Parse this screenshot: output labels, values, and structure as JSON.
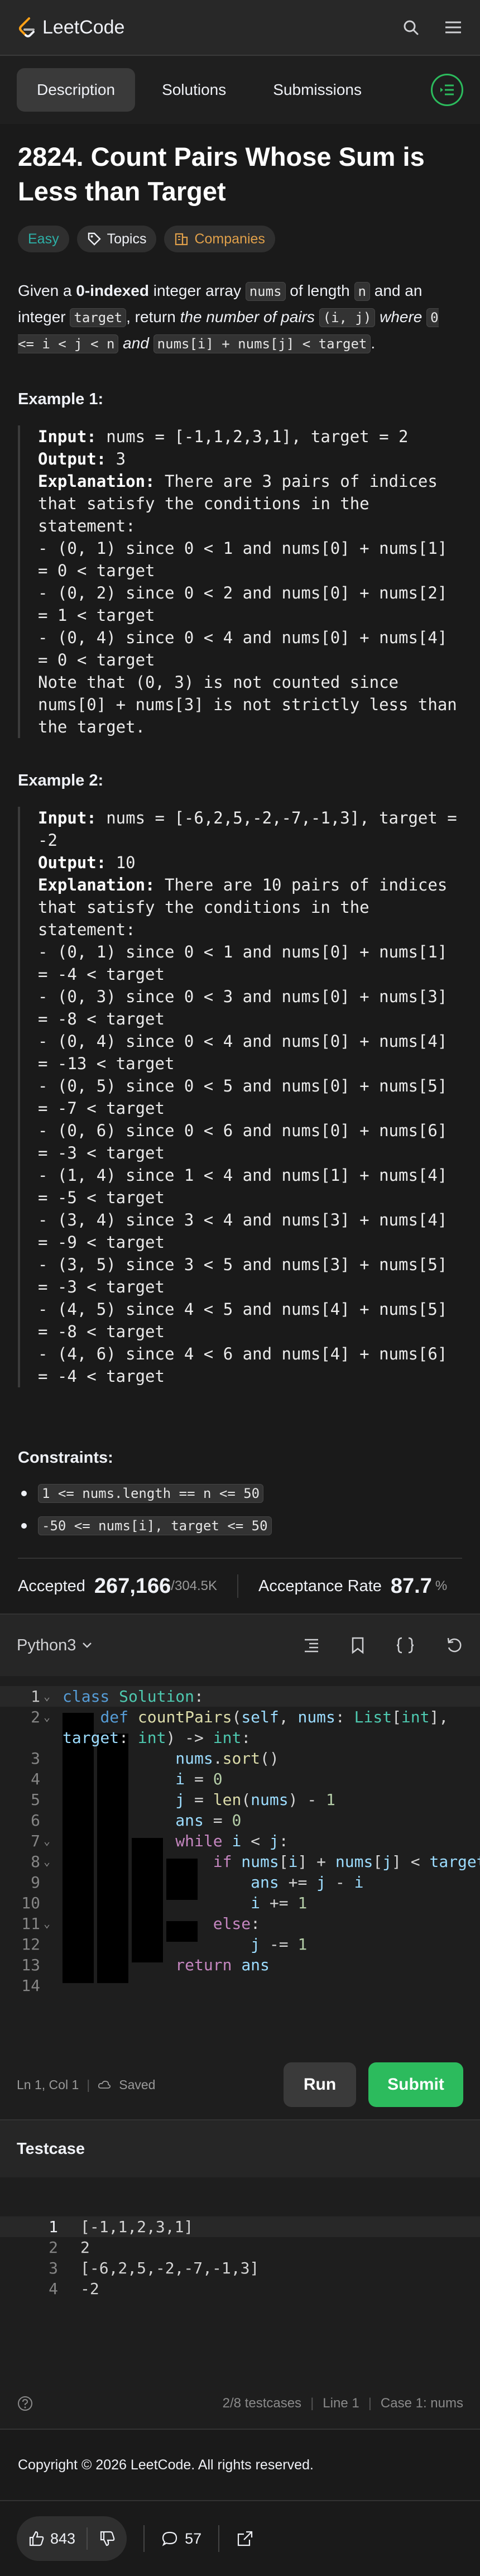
{
  "app": {
    "brand": "LeetCode"
  },
  "tabs": [
    {
      "label": "Description",
      "active": true
    },
    {
      "label": "Solutions",
      "active": false
    },
    {
      "label": "Submissions",
      "active": false
    }
  ],
  "problem": {
    "title": "2824. Count Pairs Whose Sum is Less than Target",
    "tags": {
      "difficulty": "Easy",
      "topics": "Topics",
      "companies": "Companies"
    },
    "desc": {
      "p1": "Given a ",
      "bold1": "0-indexed",
      "p2": " integer array ",
      "c_nums": "nums",
      "p3": " of length ",
      "c_n": "n",
      "p4": " and an integer ",
      "c_target": "target",
      "p5": ", return ",
      "em1": "the number of pairs",
      "c_ij": "(i, j)",
      "em2": " where ",
      "c_range": "0 <= i < j < n",
      "em3": " and ",
      "c_sum": "nums[i] + nums[j] < target",
      "p6": "."
    },
    "examples": [
      {
        "head": "Example 1:",
        "input_label": "Input:",
        "input": " nums = [-1,1,2,3,1], target = 2",
        "output_label": "Output:",
        "output": " 3",
        "expl_label": "Explanation:",
        "expl": " There are 3 pairs of indices that satisfy the conditions in the statement:\n- (0, 1) since 0 < 1 and nums[0] + nums[1] = 0 < target\n- (0, 2) since 0 < 2 and nums[0] + nums[2] = 1 < target\n- (0, 4) since 0 < 4 and nums[0] + nums[4] = 0 < target\nNote that (0, 3) is not counted since nums[0] + nums[3] is not strictly less than the target."
      },
      {
        "head": "Example 2:",
        "input_label": "Input:",
        "input": " nums = [-6,2,5,-2,-7,-1,3], target = -2",
        "output_label": "Output:",
        "output": " 10",
        "expl_label": "Explanation:",
        "expl": " There are 10 pairs of indices that satisfy the conditions in the statement:\n- (0, 1) since 0 < 1 and nums[0] + nums[1] = -4 < target\n- (0, 3) since 0 < 3 and nums[0] + nums[3] = -8 < target\n- (0, 4) since 0 < 4 and nums[0] + nums[4] = -13 < target\n- (0, 5) since 0 < 5 and nums[0] + nums[5] = -7 < target\n- (0, 6) since 0 < 6 and nums[0] + nums[6] = -3 < target\n- (1, 4) since 1 < 4 and nums[1] + nums[4] = -5 < target\n- (3, 4) since 3 < 4 and nums[3] + nums[4] = -9 < target\n- (3, 5) since 3 < 5 and nums[3] + nums[5] = -3 < target\n- (4, 5) since 4 < 5 and nums[4] + nums[5] = -8 < target\n- (4, 6) since 4 < 6 and nums[4] + nums[6] = -4 < target"
      }
    ],
    "constraints_head": "Constraints:",
    "constraints": [
      "1 <= nums.length == n <= 50",
      "-50 <= nums[i], target <= 50"
    ],
    "stats": {
      "accepted_label": "Accepted",
      "accepted_value": "267,166",
      "accepted_total": "/304.5K",
      "rate_label": "Acceptance Rate",
      "rate_value": "87.7",
      "rate_unit": "%"
    }
  },
  "editor": {
    "language": "Python3",
    "lines": [
      "1",
      "2",
      "3",
      "4",
      "5",
      "6",
      "7",
      "8",
      "9",
      "10",
      "11",
      "12",
      "13",
      "14"
    ],
    "status_pos": "Ln 1, Col 1",
    "status_saved": "Saved",
    "run": "Run",
    "submit": "Submit"
  },
  "testcase": {
    "head": "Testcase",
    "line_numbers": [
      "1",
      "2",
      "3",
      "4"
    ],
    "lines": [
      "[-1,1,2,3,1]",
      "2",
      "[-6,2,5,-2,-7,-1,3]",
      "-2"
    ],
    "footer_count": "2/8 testcases",
    "footer_line": "Line 1",
    "footer_case": "Case 1: nums"
  },
  "footer": {
    "copyright": "Copyright © 2026 LeetCode. All rights reserved.",
    "likes": "843",
    "comments": "57"
  },
  "colors": {
    "accent_green": "#2cbb5d",
    "easy": "#2db0a7",
    "companies": "#e0a04a"
  }
}
